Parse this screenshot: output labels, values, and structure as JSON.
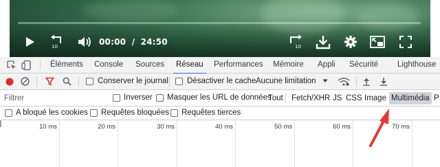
{
  "video": {
    "current_time": "00:00",
    "separator": "/",
    "duration": "24:50",
    "replay_label": "10",
    "forward_label": "10"
  },
  "devtools": {
    "tabs": [
      {
        "label": "Éléments",
        "active": false
      },
      {
        "label": "Console",
        "active": false
      },
      {
        "label": "Sources",
        "active": false
      },
      {
        "label": "Réseau",
        "active": true
      },
      {
        "label": "Performances",
        "active": false
      },
      {
        "label": "Mémoire",
        "active": false
      },
      {
        "label": "Appli",
        "active": false
      },
      {
        "label": "Sécurité",
        "active": false
      },
      {
        "label": "Lighthouse",
        "active": false
      }
    ],
    "toolbar": {
      "preserve_log_label": "Conserver le journal",
      "disable_cache_label": "Désactiver le cache",
      "throttling_label": "Aucune limitation"
    },
    "filter": {
      "placeholder": "Filtrer",
      "invert_label": "Inverser",
      "hide_data_urls_label": "Masquer les URL de données",
      "types": [
        "Tout",
        "Fetch/XHR",
        "JS",
        "CSS",
        "Image",
        "Multimédia",
        "P"
      ],
      "selected_type": "Multimédia"
    },
    "blocking": {
      "blocked_cookies_label": "A bloqué les cookies",
      "blocked_requests_label": "Requêtes bloquées",
      "third_party_label": "Requêtes tierces"
    },
    "timeline": {
      "ticks": [
        "10 ms",
        "20 ms",
        "30 ms",
        "40 ms",
        "50 ms",
        "60 ms",
        "70 ms"
      ]
    }
  },
  "colors": {
    "accent": "#1a73e8",
    "record": "#d93025",
    "filter_funnel": "#d93025",
    "annotation_arrow": "#e53935",
    "selected_type_bg": "#d0d4da"
  }
}
